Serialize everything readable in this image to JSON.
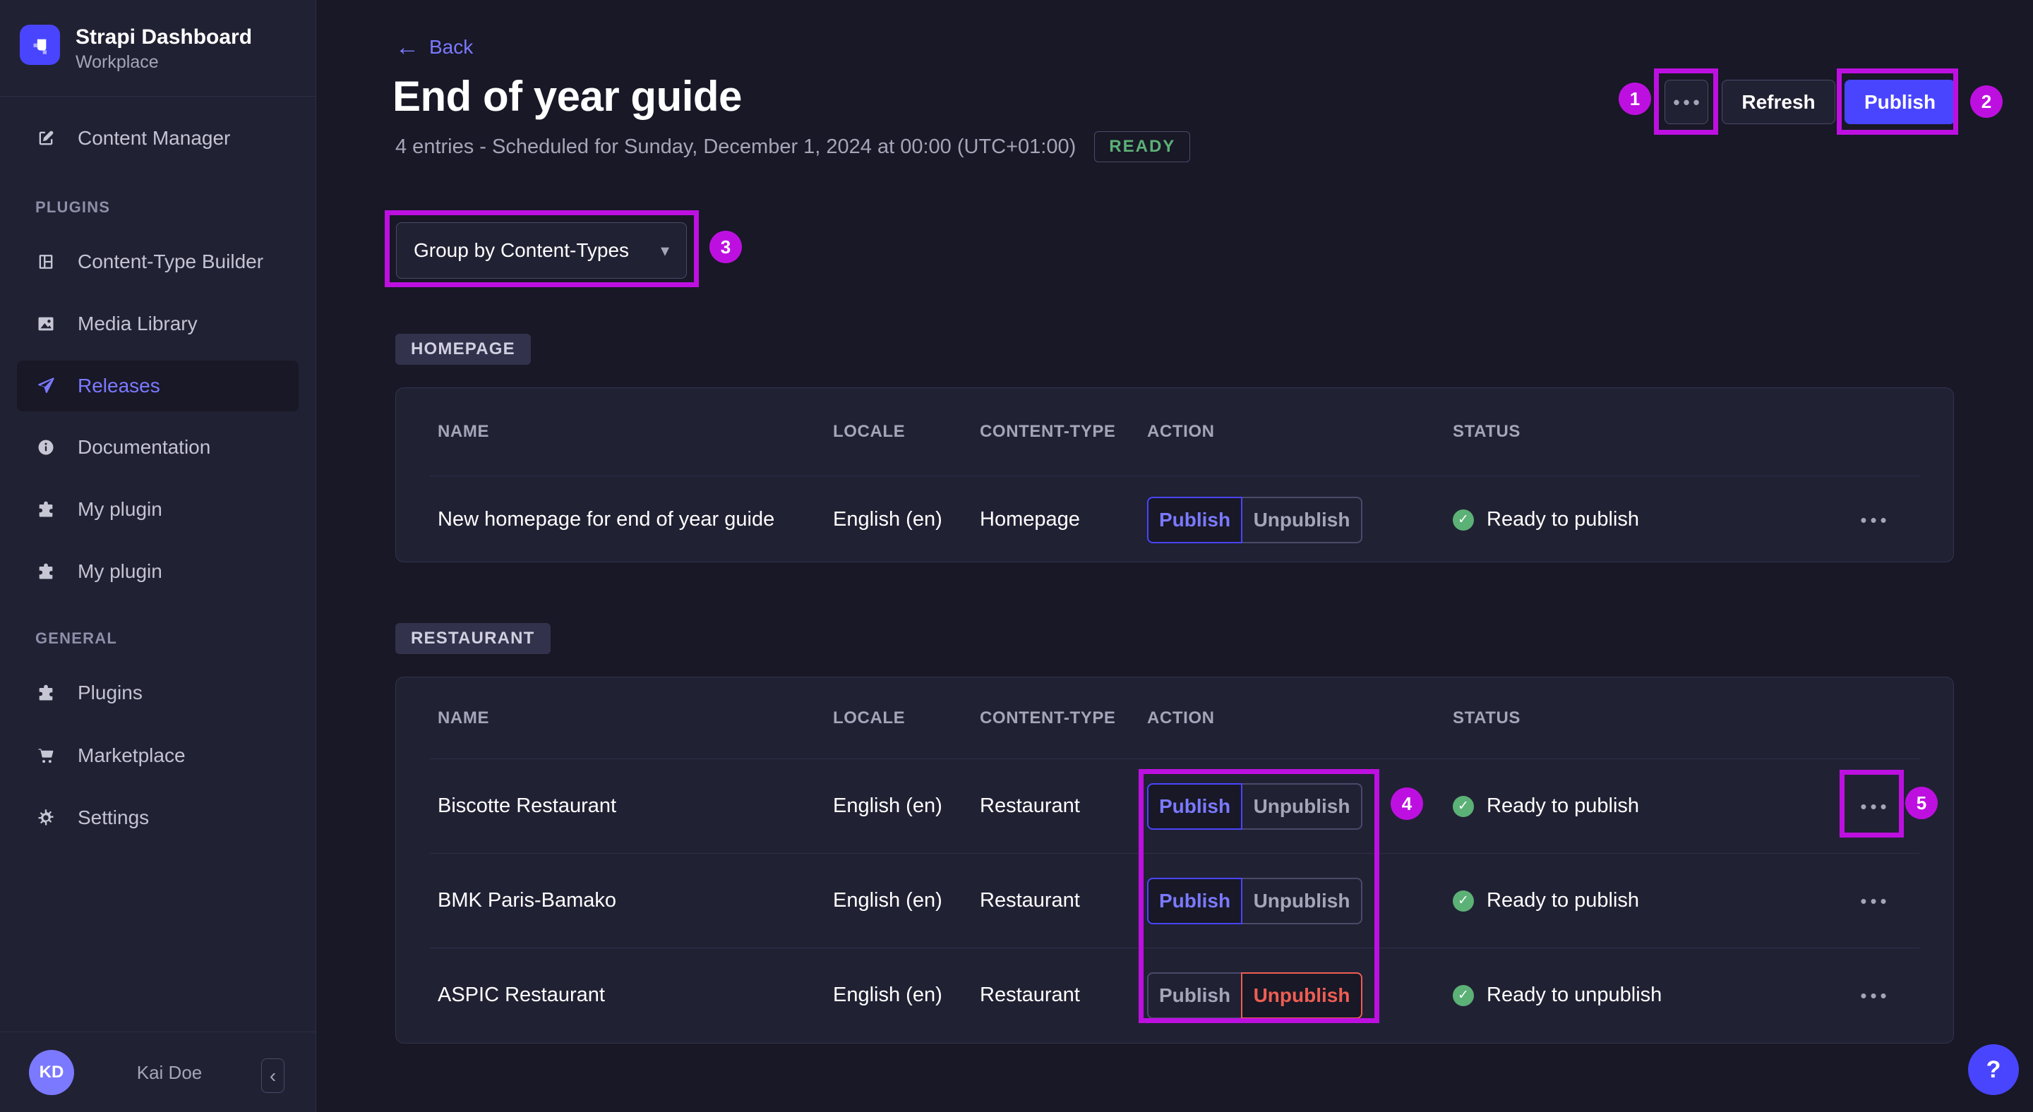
{
  "sidebar": {
    "app_name": "Strapi Dashboard",
    "workspace": "Workplace",
    "sections": {
      "plugins": "PLUGINS",
      "general": "GENERAL"
    },
    "items": {
      "content_manager": "Content Manager",
      "content_type_builder": "Content-Type Builder",
      "media_library": "Media Library",
      "releases": "Releases",
      "documentation": "Documentation",
      "my_plugin_1": "My plugin",
      "my_plugin_2": "My plugin",
      "plugins": "Plugins",
      "marketplace": "Marketplace",
      "settings": "Settings"
    },
    "user": {
      "initials": "KD",
      "name": "Kai Doe"
    }
  },
  "header": {
    "back": "Back",
    "title": "End of year guide",
    "subtitle": "4 entries - Scheduled for Sunday, December 1, 2024 at 00:00 (UTC+01:00)",
    "status_badge": "READY",
    "refresh": "Refresh",
    "publish": "Publish"
  },
  "filters": {
    "group_by": "Group by Content-Types"
  },
  "actions": {
    "publish": "Publish",
    "unpublish": "Unpublish"
  },
  "table_headers": [
    "NAME",
    "LOCALE",
    "CONTENT-TYPE",
    "ACTION",
    "STATUS"
  ],
  "groups": [
    {
      "tag": "HOMEPAGE",
      "rows": [
        {
          "name": "New homepage for end of year guide",
          "locale": "English (en)",
          "content_type": "Homepage",
          "selected_action": "publish",
          "status": "Ready to publish"
        }
      ]
    },
    {
      "tag": "RESTAURANT",
      "rows": [
        {
          "name": "Biscotte Restaurant",
          "locale": "English (en)",
          "content_type": "Restaurant",
          "selected_action": "publish",
          "status": "Ready to publish"
        },
        {
          "name": "BMK Paris-Bamako",
          "locale": "English (en)",
          "content_type": "Restaurant",
          "selected_action": "publish",
          "status": "Ready to publish"
        },
        {
          "name": "ASPIC Restaurant",
          "locale": "English (en)",
          "content_type": "Restaurant",
          "selected_action": "unpublish",
          "status": "Ready to unpublish"
        }
      ]
    }
  ],
  "annotations": {
    "n1": "1",
    "n2": "2",
    "n3": "3",
    "n4": "4",
    "n5": "5"
  },
  "icons": {
    "back_arrow": "←",
    "more": "•••",
    "caret": "▾",
    "check": "✓",
    "collapse": "‹",
    "help": "?"
  },
  "colors": {
    "accent": "#4945ff",
    "accent_light": "#7b79ff",
    "success": "#5cb176",
    "danger": "#ee5e52",
    "annotation": "#bd10e0"
  }
}
